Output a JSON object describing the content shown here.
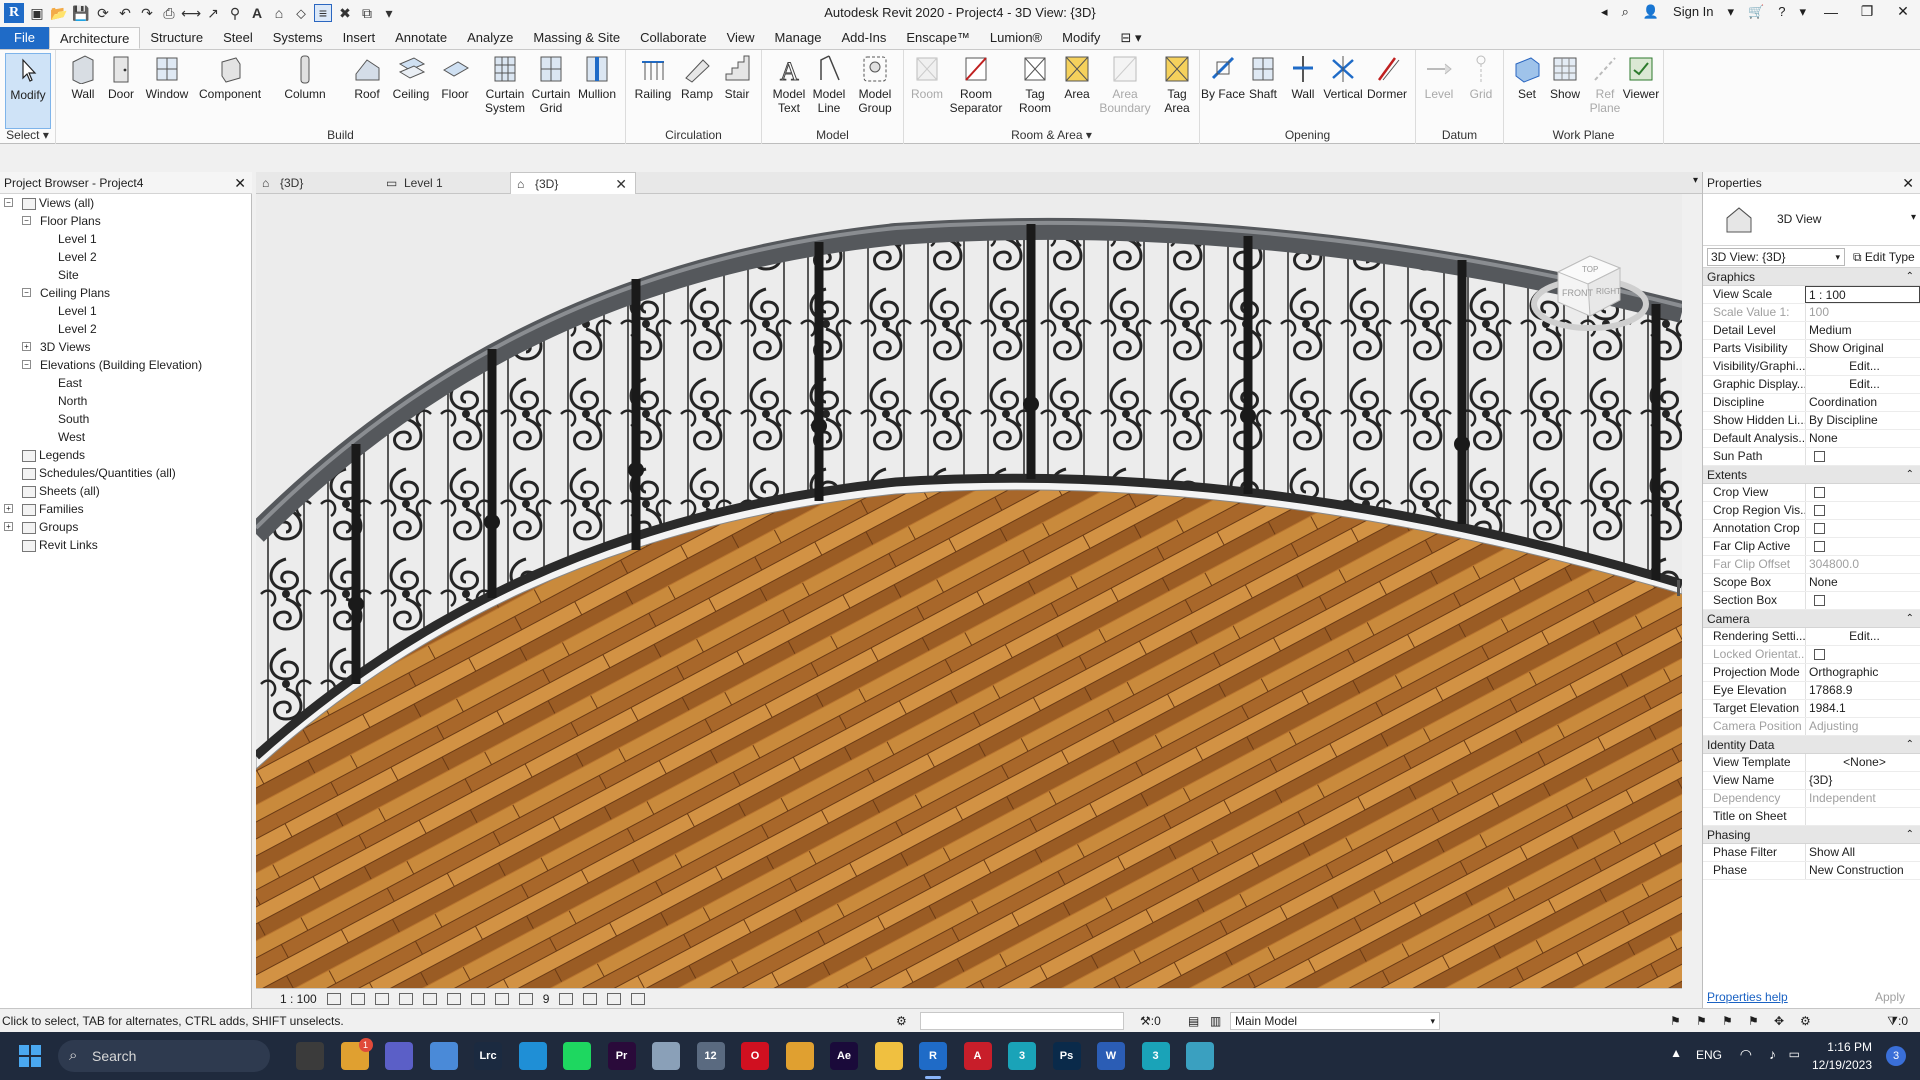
{
  "app": {
    "title": "Autodesk Revit 2020 - Project4 - 3D View: {3D}",
    "sign_in": "Sign In"
  },
  "ribbon_tabs": [
    "File",
    "Architecture",
    "Structure",
    "Steel",
    "Systems",
    "Insert",
    "Annotate",
    "Analyze",
    "Massing & Site",
    "Collaborate",
    "View",
    "Manage",
    "Add-Ins",
    "Enscape™",
    "Lumion®",
    "Modify"
  ],
  "ribbon": {
    "select": {
      "modify": "Modify",
      "label": "Select"
    },
    "build": {
      "label": "Build",
      "buttons": [
        "Wall",
        "Door",
        "Window",
        "Component",
        "Column",
        "Roof",
        "Ceiling",
        "Floor",
        "Curtain System",
        "Curtain Grid",
        "Mullion"
      ]
    },
    "circulation": {
      "label": "Circulation",
      "buttons": [
        "Railing",
        "Ramp",
        "Stair"
      ]
    },
    "model": {
      "label": "Model",
      "buttons": [
        "Model Text",
        "Model Line",
        "Model Group"
      ]
    },
    "room_area": {
      "label": "Room & Area",
      "buttons": [
        "Room",
        "Room Separator",
        "Tag Room",
        "Area",
        "Area Boundary",
        "Tag Area"
      ]
    },
    "opening": {
      "label": "Opening",
      "buttons": [
        "By Face",
        "Shaft",
        "Wall",
        "Vertical",
        "Dormer"
      ]
    },
    "datum": {
      "label": "Datum",
      "buttons": [
        "Level",
        "Grid"
      ]
    },
    "work_plane": {
      "label": "Work Plane",
      "buttons": [
        "Set",
        "Show",
        "Ref Plane",
        "Viewer"
      ]
    }
  },
  "browser": {
    "title": "Project Browser - Project4",
    "nodes": [
      {
        "label": "Views (all)",
        "level": 0,
        "tog": "−"
      },
      {
        "label": "Floor Plans",
        "level": 1,
        "tog": "−"
      },
      {
        "label": "Level 1",
        "level": 2
      },
      {
        "label": "Level 2",
        "level": 2
      },
      {
        "label": "Site",
        "level": 2
      },
      {
        "label": "Ceiling Plans",
        "level": 1,
        "tog": "−"
      },
      {
        "label": "Level 1",
        "level": 2
      },
      {
        "label": "Level 2",
        "level": 2
      },
      {
        "label": "3D Views",
        "level": 1,
        "tog": "+"
      },
      {
        "label": "Elevations (Building Elevation)",
        "level": 1,
        "tog": "−"
      },
      {
        "label": "East",
        "level": 2
      },
      {
        "label": "North",
        "level": 2
      },
      {
        "label": "South",
        "level": 2
      },
      {
        "label": "West",
        "level": 2
      },
      {
        "label": "Legends",
        "level": 0
      },
      {
        "label": "Schedules/Quantities (all)",
        "level": 0
      },
      {
        "label": "Sheets (all)",
        "level": 0
      },
      {
        "label": "Families",
        "level": 0,
        "tog": "+"
      },
      {
        "label": "Groups",
        "level": 0,
        "tog": "+"
      },
      {
        "label": "Revit Links",
        "level": 0
      }
    ]
  },
  "view_tabs": [
    {
      "label": "{3D}",
      "active": false
    },
    {
      "label": "Level 1",
      "active": false
    },
    {
      "label": "{3D}",
      "active": true
    }
  ],
  "viewcube": {
    "top": "TOP",
    "front": "FRONT",
    "right": "RIGHT"
  },
  "view_control": {
    "scale": "1 : 100",
    "hidden_count": "9"
  },
  "properties": {
    "title": "Properties",
    "type_name": "3D View",
    "instance": "3D View: {3D}",
    "edit_type": "Edit Type",
    "categories": [
      {
        "name": "Graphics",
        "rows": [
          {
            "n": "View Scale",
            "v": "1 : 100",
            "style": "boxed"
          },
          {
            "n": "Scale Value    1:",
            "v": "100",
            "dim": true
          },
          {
            "n": "Detail Level",
            "v": "Medium"
          },
          {
            "n": "Parts Visibility",
            "v": "Show Original"
          },
          {
            "n": "Visibility/Graphi...",
            "v": "Edit...",
            "style": "btn"
          },
          {
            "n": "Graphic Display...",
            "v": "Edit...",
            "style": "btn"
          },
          {
            "n": "Discipline",
            "v": "Coordination"
          },
          {
            "n": "Show Hidden Li...",
            "v": "By Discipline"
          },
          {
            "n": "Default Analysis...",
            "v": "None"
          },
          {
            "n": "Sun Path",
            "v": "",
            "check": true
          }
        ]
      },
      {
        "name": "Extents",
        "rows": [
          {
            "n": "Crop View",
            "v": "",
            "check": true
          },
          {
            "n": "Crop Region Vis...",
            "v": "",
            "check": true
          },
          {
            "n": "Annotation Crop",
            "v": "",
            "check": true
          },
          {
            "n": "Far Clip Active",
            "v": "",
            "check": true
          },
          {
            "n": "Far Clip Offset",
            "v": "304800.0",
            "dim": true
          },
          {
            "n": "Scope Box",
            "v": "None"
          },
          {
            "n": "Section Box",
            "v": "",
            "check": true
          }
        ]
      },
      {
        "name": "Camera",
        "rows": [
          {
            "n": "Rendering Setti...",
            "v": "Edit...",
            "style": "btn"
          },
          {
            "n": "Locked Orientat...",
            "v": "",
            "check": true,
            "dim": true
          },
          {
            "n": "Projection Mode",
            "v": "Orthographic"
          },
          {
            "n": "Eye Elevation",
            "v": "17868.9"
          },
          {
            "n": "Target Elevation",
            "v": "1984.1"
          },
          {
            "n": "Camera Position",
            "v": "Adjusting",
            "dim": true
          }
        ]
      },
      {
        "name": "Identity Data",
        "rows": [
          {
            "n": "View Template",
            "v": "<None>",
            "style": "btn"
          },
          {
            "n": "View Name",
            "v": "{3D}"
          },
          {
            "n": "Dependency",
            "v": "Independent",
            "dim": true
          },
          {
            "n": "Title on Sheet",
            "v": ""
          }
        ]
      },
      {
        "name": "Phasing",
        "rows": [
          {
            "n": "Phase Filter",
            "v": "Show All"
          },
          {
            "n": "Phase",
            "v": "New Construction"
          }
        ]
      }
    ],
    "help": "Properties help",
    "apply": "Apply"
  },
  "status": {
    "message": "Click to select, TAB for alternates, CTRL adds, SHIFT unselects.",
    "zero": ":0",
    "model": "Main Model",
    "filter": ":0"
  },
  "taskbar": {
    "search": "Search",
    "lang": "ENG",
    "time": "1:16 PM",
    "date": "12/19/2023",
    "badge": "3",
    "teams_badge": "1",
    "apps": [
      {
        "name": "file-explorer-dark-icon",
        "label": "",
        "color": "#3b3b3b"
      },
      {
        "name": "widgets-icon",
        "label": "",
        "color": "#e0a030"
      },
      {
        "name": "teams-icon",
        "label": "",
        "color": "#5b5fc7"
      },
      {
        "name": "photos-icon",
        "label": "",
        "color": "#4a8ad8"
      },
      {
        "name": "lightroom-icon",
        "label": "Lrc",
        "color": "#1b2a40"
      },
      {
        "name": "edge-icon",
        "label": "",
        "color": "#1f8fd6"
      },
      {
        "name": "spotify-icon",
        "label": "",
        "color": "#1ed760"
      },
      {
        "name": "premiere-icon",
        "label": "Pr",
        "color": "#2a0a3a"
      },
      {
        "name": "disk-app-icon",
        "label": "",
        "color": "#8aa0b8"
      },
      {
        "name": "calendar-app-icon",
        "label": "12",
        "color": "#5a6a80"
      },
      {
        "name": "opera-icon",
        "label": "O",
        "color": "#d01020"
      },
      {
        "name": "media-player-icon",
        "label": "",
        "color": "#e0a030"
      },
      {
        "name": "after-effects-icon",
        "label": "Ae",
        "color": "#1a0a3a"
      },
      {
        "name": "folder-icon",
        "label": "",
        "color": "#f0c040"
      },
      {
        "name": "revit-icon",
        "label": "R",
        "color": "#1f6bc7"
      },
      {
        "name": "autocad-icon",
        "label": "A",
        "color": "#c81e2a"
      },
      {
        "name": "3dsmax-icon",
        "label": "3",
        "color": "#1aa3b8"
      },
      {
        "name": "photoshop-icon",
        "label": "Ps",
        "color": "#0a2a4a"
      },
      {
        "name": "word-icon",
        "label": "W",
        "color": "#2b5db5"
      },
      {
        "name": "3dsmax2-icon",
        "label": "3",
        "color": "#1aa3b8"
      },
      {
        "name": "globe-app-icon",
        "label": "",
        "color": "#3aa0c0"
      }
    ]
  },
  "colors": {
    "accent": "#1f6bc7",
    "railing": "#1a1a1a",
    "handrail": "#55585c",
    "floor": "#b8742e"
  }
}
